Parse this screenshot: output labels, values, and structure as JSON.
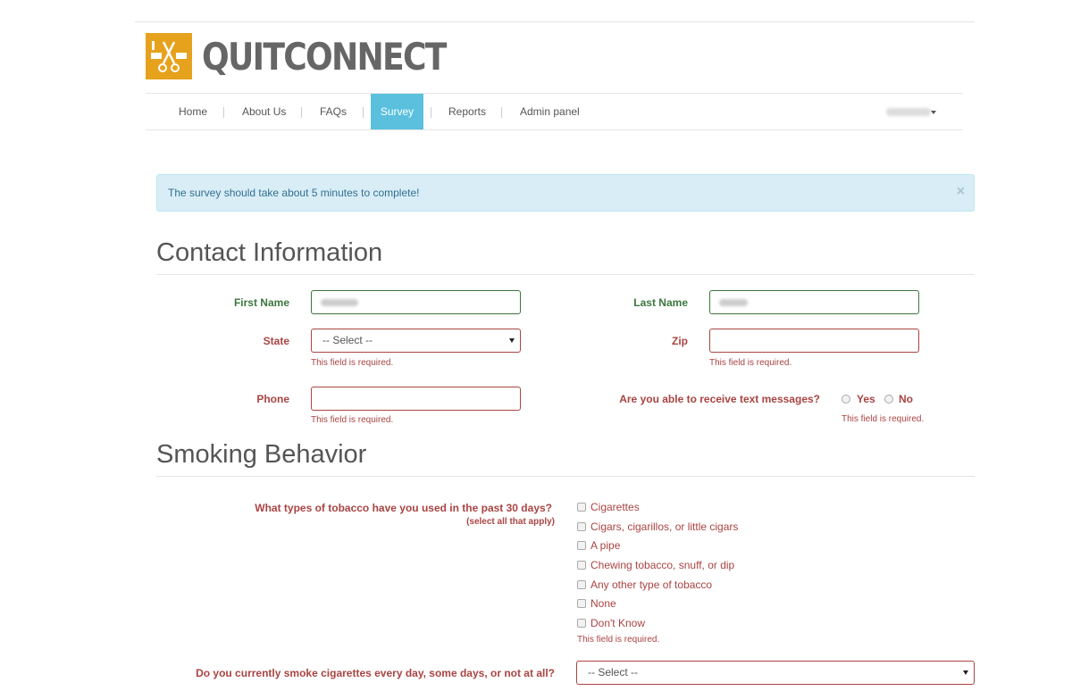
{
  "brand": {
    "name": "QUITCONNECT",
    "logo_icon": "scissors-cigarette-icon",
    "accent": "#e6a21d"
  },
  "nav": {
    "items": [
      {
        "label": "Home"
      },
      {
        "label": "About Us"
      },
      {
        "label": "FAQs"
      },
      {
        "label": "Survey",
        "active": true
      },
      {
        "label": "Reports"
      },
      {
        "label": "Admin panel"
      }
    ]
  },
  "alert": {
    "text": "The survey should take about 5 minutes to complete!",
    "close": "×"
  },
  "contact": {
    "title": "Contact Information",
    "first_name_label": "First Name",
    "last_name_label": "Last Name",
    "state_label": "State",
    "state_value": "-- Select --",
    "zip_label": "Zip",
    "phone_label": "Phone",
    "text_label": "Are you able to receive text messages?",
    "yes_label": "Yes",
    "no_label": "No",
    "required": "This field is required."
  },
  "smoking": {
    "title": "Smoking Behavior",
    "tobacco_question": "What types of tobacco have you used in the past 30 days?",
    "tobacco_hint": "(select all that apply)",
    "options": [
      "Cigarettes",
      "Cigars, cigarillos, or little cigars",
      "A pipe",
      "Chewing tobacco, snuff, or dip",
      "Any other type of tobacco",
      "None",
      "Don't Know"
    ],
    "required": "This field is required.",
    "frequency_question": "Do you currently smoke cigarettes every day, some days, or not at all?",
    "frequency_value": "-- Select --"
  },
  "colors": {
    "error": "#a94442",
    "success": "#3c763d",
    "info_bg": "#d9edf7",
    "nav_active": "#5bc0de"
  }
}
